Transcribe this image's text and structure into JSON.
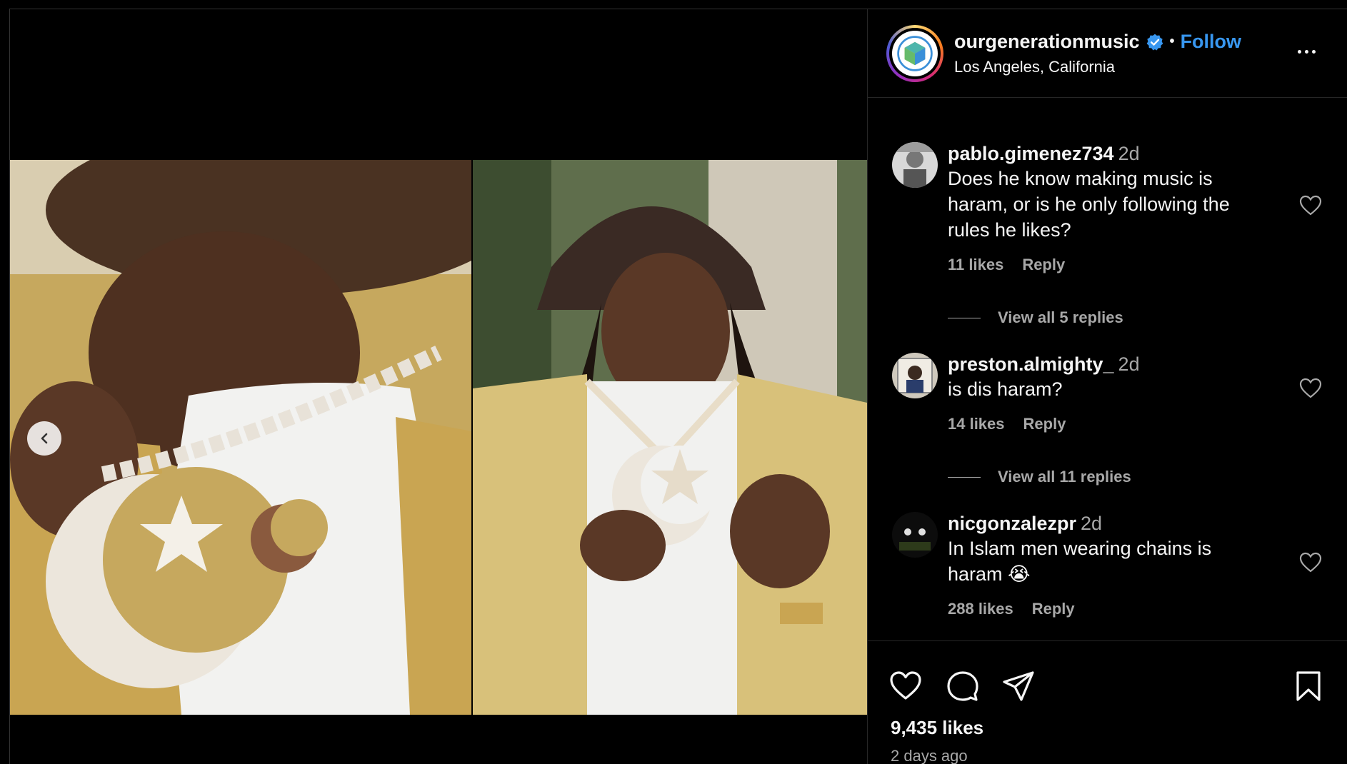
{
  "post": {
    "username": "ourgenerationmusic",
    "follow_label": "Follow",
    "separator": "•",
    "location": "Los Angeles, California",
    "likes": "9,435 likes",
    "time_ago": "2 days ago"
  },
  "comments": [
    {
      "user": "pablo.gimenez734",
      "time": "2d",
      "lines": [
        "Does he know making music is",
        "haram, or is he only following the",
        "rules he likes?"
      ],
      "likes": "11 likes",
      "reply_label": "Reply",
      "view_replies": "View all 5 replies"
    },
    {
      "user": "preston.almighty_",
      "time": "2d",
      "lines": [
        "is dis haram?"
      ],
      "likes": "14 likes",
      "reply_label": "Reply",
      "view_replies": "View all 11 replies"
    },
    {
      "user": "nicgonzalezpr",
      "time": "2d",
      "lines": [
        "In Islam men wearing chains is",
        "haram 😭"
      ],
      "likes": "288 likes",
      "reply_label": "Reply"
    }
  ],
  "colors": {
    "accent": "#3897f0",
    "verified": "#3897f0",
    "muted_text": "#a8a8a8",
    "background": "#000000"
  },
  "icons": {
    "prev": "chevron-left-icon",
    "verified": "verified-badge-icon",
    "more": "more-options-icon",
    "like": "heart-icon",
    "comment": "comment-icon",
    "share": "share-icon",
    "save": "bookmark-icon"
  }
}
